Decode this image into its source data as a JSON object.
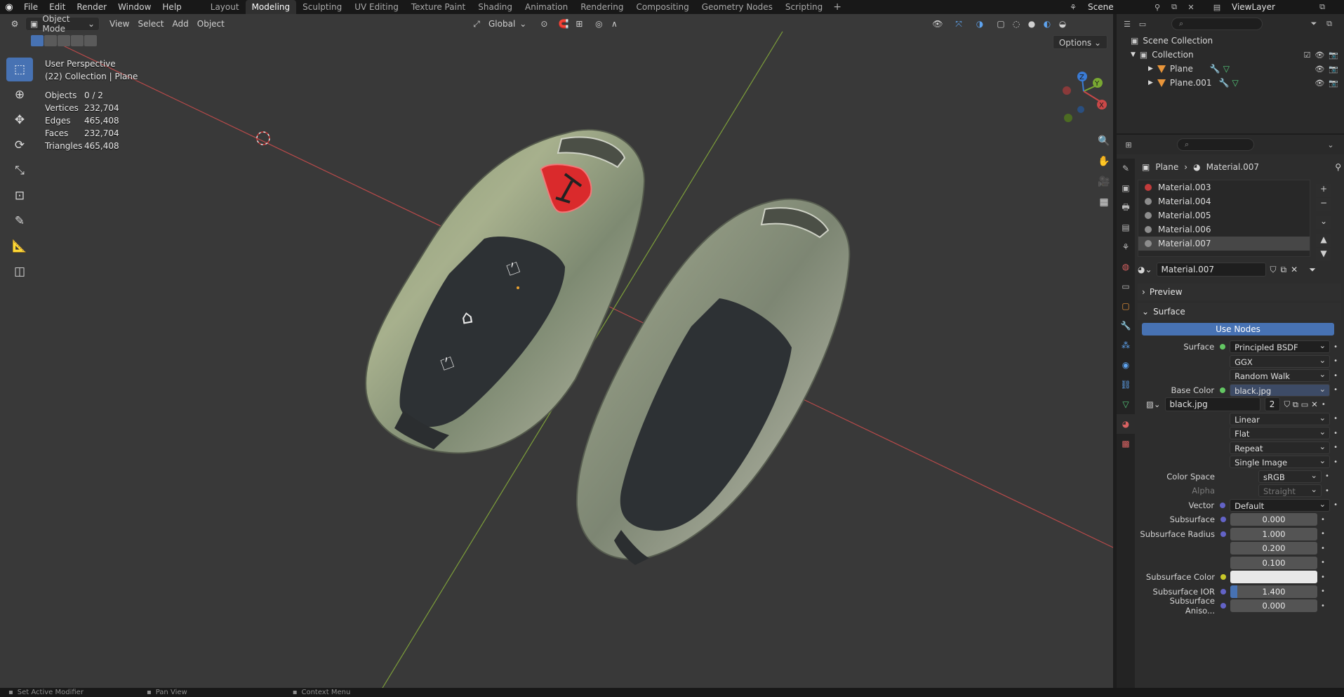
{
  "topbar": {
    "menus": [
      "File",
      "Edit",
      "Render",
      "Window",
      "Help"
    ],
    "workspaces": [
      "Layout",
      "Modeling",
      "Sculpting",
      "UV Editing",
      "Texture Paint",
      "Shading",
      "Animation",
      "Rendering",
      "Compositing",
      "Geometry Nodes",
      "Scripting"
    ],
    "active_workspace": "Modeling",
    "scene": "Scene",
    "view_layer": "ViewLayer"
  },
  "viewport_header": {
    "mode": "Object Mode",
    "menus": [
      "View",
      "Select",
      "Add",
      "Object"
    ],
    "orientation": "Global",
    "options": "Options"
  },
  "viewport": {
    "perspective": "User Perspective",
    "collection_info": "(22) Collection | Plane",
    "stats": [
      {
        "k": "Objects",
        "v": "0 / 2"
      },
      {
        "k": "Vertices",
        "v": "232,704"
      },
      {
        "k": "Edges",
        "v": "465,408"
      },
      {
        "k": "Faces",
        "v": "232,704"
      },
      {
        "k": "Triangles",
        "v": "465,408"
      }
    ],
    "gizmo_axes": {
      "x": "X",
      "y": "Y",
      "z": "Z"
    }
  },
  "outliner": {
    "rows": [
      {
        "label": "Scene Collection"
      },
      {
        "label": "Collection"
      },
      {
        "label": "Plane"
      },
      {
        "label": "Plane.001"
      }
    ]
  },
  "properties": {
    "breadcrumb_object": "Plane",
    "breadcrumb_material": "Material.007",
    "materials": [
      "Material.003",
      "Material.004",
      "Material.005",
      "Material.006",
      "Material.007"
    ],
    "selected_material": "Material.007",
    "material_name": "Material.007",
    "preview_label": "Preview",
    "surface_label": "Surface",
    "use_nodes": "Use Nodes",
    "rows": [
      {
        "label": "Surface",
        "value": "Principled BSDF",
        "type": "shader"
      },
      {
        "label": "",
        "value": "GGX",
        "type": "dropdown"
      },
      {
        "label": "",
        "value": "Random Walk",
        "type": "dropdown"
      },
      {
        "label": "Base Color",
        "value": "black.jpg",
        "type": "texture"
      },
      {
        "label": "",
        "value": "black.jpg",
        "type": "image",
        "users": "2"
      },
      {
        "label": "",
        "value": "Linear",
        "type": "dropdown"
      },
      {
        "label": "",
        "value": "Flat",
        "type": "dropdown"
      },
      {
        "label": "",
        "value": "Repeat",
        "type": "dropdown"
      },
      {
        "label": "",
        "value": "Single Image",
        "type": "dropdown"
      },
      {
        "label": "Color Space",
        "value": "sRGB",
        "type": "dropdown-short"
      },
      {
        "label": "Alpha",
        "value": "Straight",
        "type": "dropdown-dim"
      },
      {
        "label": "Vector",
        "value": "Default",
        "type": "vector"
      },
      {
        "label": "Subsurface",
        "value": "0.000",
        "type": "number"
      },
      {
        "label": "Subsurface Radius",
        "value": "1.000",
        "type": "number"
      },
      {
        "label": "",
        "value": "0.200",
        "type": "number"
      },
      {
        "label": "",
        "value": "0.100",
        "type": "number"
      },
      {
        "label": "Subsurface Color",
        "value": "",
        "type": "color"
      },
      {
        "label": "Subsurface IOR",
        "value": "1.400",
        "type": "number-bar"
      },
      {
        "label": "Subsurface Aniso...",
        "value": "0.000",
        "type": "number"
      }
    ]
  },
  "statusbar": {
    "items": [
      "Set Active Modifier",
      "Pan View",
      "Context Menu"
    ]
  },
  "colors": {
    "accent": "#4772b3",
    "x_axis": "#c94848",
    "y_axis": "#79a832",
    "key_red": "#d9262a"
  }
}
